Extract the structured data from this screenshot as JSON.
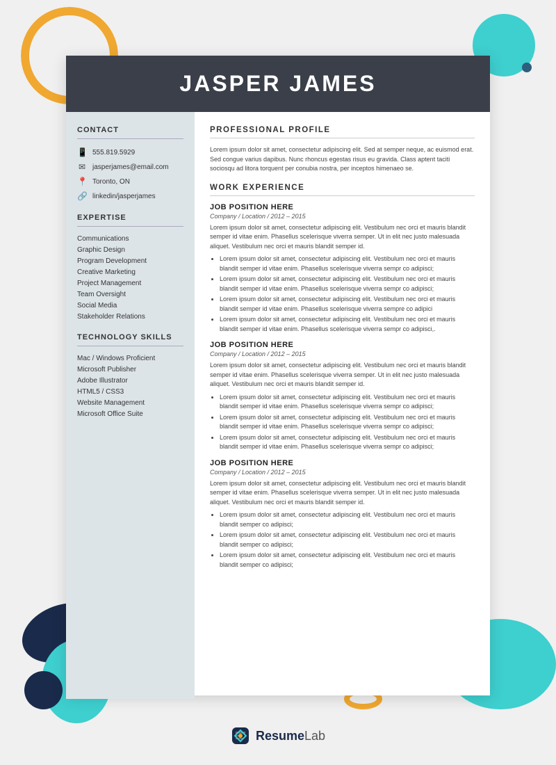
{
  "background": {
    "color": "#f0f0f0"
  },
  "header": {
    "name": "JASPER JAMES"
  },
  "sidebar": {
    "contact": {
      "title": "CONTACT",
      "phone": "555.819.5929",
      "email": "jasperjames@email.com",
      "location": "Toronto, ON",
      "linkedin": "linkedin/jasperjames"
    },
    "expertise": {
      "title": "EXPERTISE",
      "items": [
        "Communications",
        "Graphic Design",
        "Program Development",
        "Creative Marketing",
        "Project Management",
        "Team Oversight",
        "Social Media",
        "Stakeholder Relations"
      ]
    },
    "technology": {
      "title": "TECHNOLOGY SKILLS",
      "items": [
        "Mac / Windows Proficient",
        "Microsoft Publisher",
        "Adobe Illustrator",
        "HTML5 / CSS3",
        "Website Management",
        "Microsoft Office Suite"
      ]
    }
  },
  "main": {
    "profile": {
      "title": "PROFESSIONAL PROFILE",
      "text": "Lorem ipsum dolor sit amet, consectetur adipiscing elit. Sed at semper neque, ac euismod erat. Sed congue varius dapibus. Nunc rhoncus egestas risus eu gravida. Class aptent taciti sociosqu ad litora torquent per conubia nostra, per inceptos himenaeo se."
    },
    "work_experience": {
      "title": "WORK EXPERIENCE",
      "jobs": [
        {
          "title": "JOB POSITION HERE",
          "meta": "Company / Location / 2012 – 2015",
          "description": "Lorem ipsum dolor sit amet, consectetur adipiscing elit. Vestibulum nec orci et mauris blandit semper id vitae enim. Phasellus scelerisque viverra semper. Ut in elit nec justo malesuada aliquet. Vestibulum nec orci et mauris blandit semper id.",
          "bullets": [
            "Lorem ipsum dolor sit amet, consectetur adipiscing elit. Vestibulum nec orci et mauris blandit semper id vitae enim. Phasellus scelerisque viverra sempr co adipisci;",
            "Lorem ipsum dolor sit amet, consectetur adipiscing elit. Vestibulum nec orci et mauris blandit semper id vitae enim. Phasellus scelerisque viverra sempr co adipisci;",
            "Lorem ipsum dolor sit amet, consectetur adipiscing elit. Vestibulum nec orci et mauris blandit semper id vitae enim. Phasellus scelerisque viverra sempre co adipici",
            "Lorem ipsum dolor sit amet, consectetur adipiscing elit. Vestibulum nec orci et mauris blandit semper id vitae enim. Phasellus scelerisque viverra sempr co adipisci,."
          ]
        },
        {
          "title": "JOB POSITION HERE",
          "meta": "Company / Location /  2012 – 2015",
          "description": "Lorem ipsum dolor sit amet, consectetur adipiscing elit. Vestibulum nec orci et mauris blandit semper id vitae enim. Phasellus scelerisque viverra semper. Ut in elit nec justo malesuada aliquet. Vestibulum nec orci et mauris blandit semper id.",
          "bullets": [
            "Lorem ipsum dolor sit amet, consectetur adipiscing elit. Vestibulum nec orci et mauris blandit semper id vitae enim. Phasellus scelerisque viverra sempr co adipisci;",
            "Lorem ipsum dolor sit amet, consectetur adipiscing elit. Vestibulum nec orci et mauris blandit semper id vitae enim. Phasellus scelerisque viverra sempr co adipisci;",
            "Lorem ipsum dolor sit amet, consectetur adipiscing elit. Vestibulum nec orci et mauris blandit semper id vitae enim. Phasellus scelerisque viverra sempr co adipisci;"
          ]
        },
        {
          "title": "JOB POSITION HERE",
          "meta": "Company / Location / 2012 – 2015",
          "description": "Lorem ipsum dolor sit amet, consectetur adipiscing elit. Vestibulum nec orci et mauris blandit semper id vitae enim. Phasellus scelerisque viverra semper. Ut in elit nec justo malesuada aliquet. Vestibulum nec orci et mauris blandit semper id.",
          "bullets": [
            "Lorem ipsum dolor sit amet, consectetur adipiscing elit. Vestibulum nec orci et mauris blandit semper co adipisci;",
            "Lorem ipsum dolor sit amet, consectetur adipiscing elit. Vestibulum nec orci et mauris blandit semper co adipisci;",
            "Lorem ipsum dolor sit amet, consectetur adipiscing elit. Vestibulum nec orci et mauris blandit semper co adipisci;"
          ]
        }
      ]
    }
  },
  "branding": {
    "name": "ResumeLab",
    "name_bold": "Resume",
    "name_light": "Lab"
  }
}
